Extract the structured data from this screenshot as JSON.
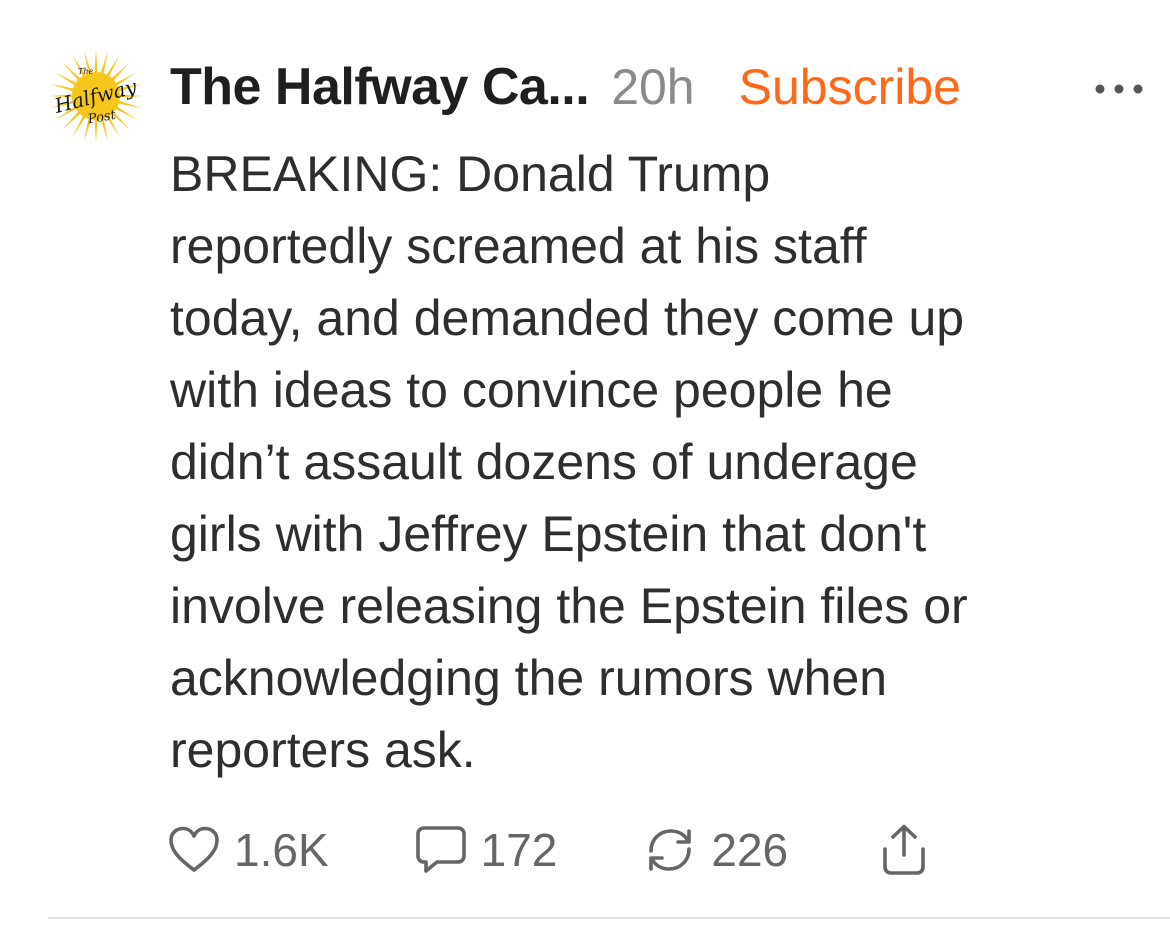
{
  "post": {
    "author": "The Halfway Ca...",
    "time_ago": "20h",
    "subscribe_label": "Subscribe",
    "body_lines": [
      "BREAKING: Donald Trump",
      "reportedly screamed at his staff",
      "today, and demanded they come up",
      "with ideas to convince people he",
      "didn’t assault dozens of underage",
      "girls with Jeffrey Epstein that don't",
      "involve releasing the Epstein files or",
      "acknowledging the rumors when",
      "reporters ask."
    ]
  },
  "avatar": {
    "logo_text_small": "The",
    "logo_text_main": "Halfway",
    "logo_text_sub": "Post"
  },
  "actions": {
    "likes": "1.6K",
    "comments": "172",
    "restacks": "226"
  },
  "icons": {
    "like": "heart-icon",
    "comment": "speech-bubble-icon",
    "restack": "repost-arrows-icon",
    "share": "share-icon",
    "more": "more-horizontal-icon"
  },
  "colors": {
    "accent": "#ff6719",
    "logo_yellow": "#f6c61c",
    "text": "#2e2e2e",
    "muted": "#8a8a8a"
  }
}
